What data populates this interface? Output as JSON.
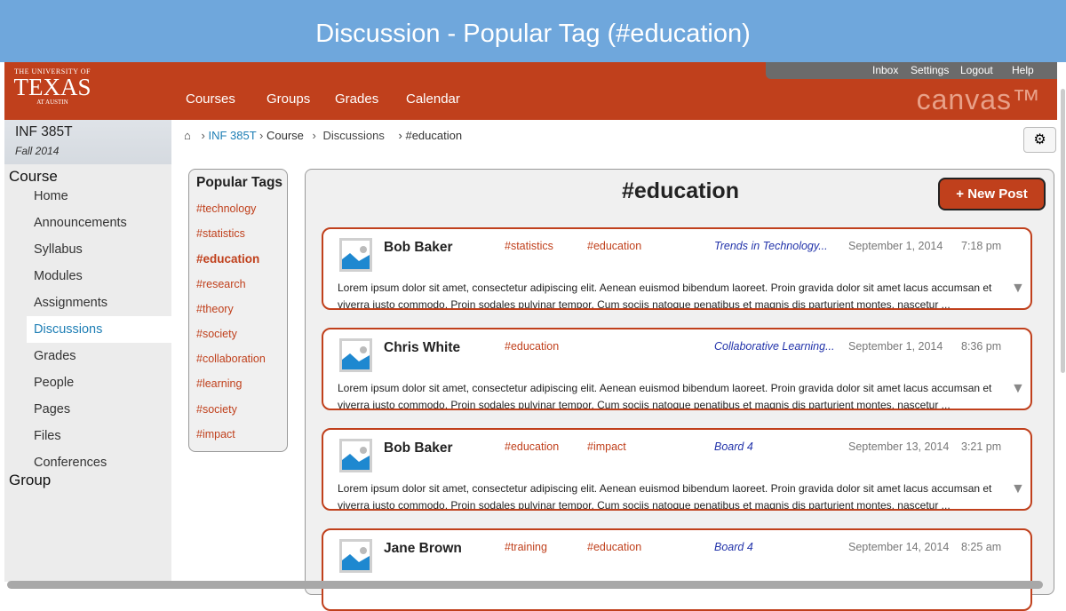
{
  "title": "Discussion - Popular Tag (#education)",
  "header": {
    "logo": {
      "top": "THE UNIVERSITY OF",
      "main": "TEXAS",
      "bottom": "AT AUSTIN"
    },
    "nav": [
      "Courses",
      "Groups",
      "Grades",
      "Calendar"
    ],
    "top_links": [
      "Inbox",
      "Settings",
      "Logout",
      "Help"
    ],
    "brand": "canvas™"
  },
  "course": {
    "code": "INF 385T",
    "term": "Fall 2014"
  },
  "sidebar": {
    "section1": "Course",
    "items": [
      "Home",
      "Announcements",
      "Syllabus",
      "Modules",
      "Assignments",
      "Discussions",
      "Grades",
      "People",
      "Pages",
      "Files",
      "Conferences"
    ],
    "active": "Discussions",
    "section2": "Group"
  },
  "breadcrumb": [
    "INF 385T",
    "Course",
    "Discussions",
    "#education"
  ],
  "popular_tags": {
    "title": "Popular Tags",
    "tags": [
      "#technology",
      "#statistics",
      "#education",
      "#research",
      "#theory",
      "#society",
      "#collaboration",
      "#learning",
      "#society",
      "#impact"
    ],
    "active": "#education"
  },
  "main": {
    "heading": "#education",
    "new_post": "+ New Post",
    "posts": [
      {
        "author": "Bob Baker",
        "tags": [
          "#statistics",
          "#education"
        ],
        "board": "Trends in Technology...",
        "date": "September 1, 2014",
        "time": "7:18 pm",
        "body": "Lorem ipsum dolor sit amet, consectetur adipiscing elit. Aenean euismod bibendum laoreet. Proin gravida dolor sit amet lacus accumsan et viverra justo commodo. Proin sodales pulvinar tempor. Cum sociis natoque penatibus et magnis dis parturient montes, nascetur ..."
      },
      {
        "author": "Chris White",
        "tags": [
          "#education",
          ""
        ],
        "board": "Collaborative Learning...",
        "date": "September 1, 2014",
        "time": "8:36 pm",
        "body": "Lorem ipsum dolor sit amet, consectetur adipiscing elit. Aenean euismod bibendum laoreet. Proin gravida dolor sit amet lacus accumsan et viverra justo commodo. Proin sodales pulvinar tempor. Cum sociis natoque penatibus et magnis dis parturient montes, nascetur ..."
      },
      {
        "author": "Bob Baker",
        "tags": [
          "#education",
          "#impact"
        ],
        "board": "Board 4",
        "date": "September 13, 2014",
        "time": "3:21 pm",
        "body": "Lorem ipsum dolor sit amet, consectetur adipiscing elit. Aenean euismod bibendum laoreet. Proin gravida dolor sit amet lacus accumsan et viverra justo commodo. Proin sodales pulvinar tempor. Cum sociis natoque penatibus et magnis dis parturient montes, nascetur ..."
      },
      {
        "author": "Jane Brown",
        "tags": [
          "#training",
          "#education"
        ],
        "board": "Board 4",
        "date": "September 14, 2014",
        "time": "8:25 am",
        "body": ""
      }
    ]
  },
  "colors": {
    "brand": "#c0401c",
    "titlebar": "#6fa7dc",
    "link": "#1d7eb5",
    "board": "#2233aa"
  }
}
